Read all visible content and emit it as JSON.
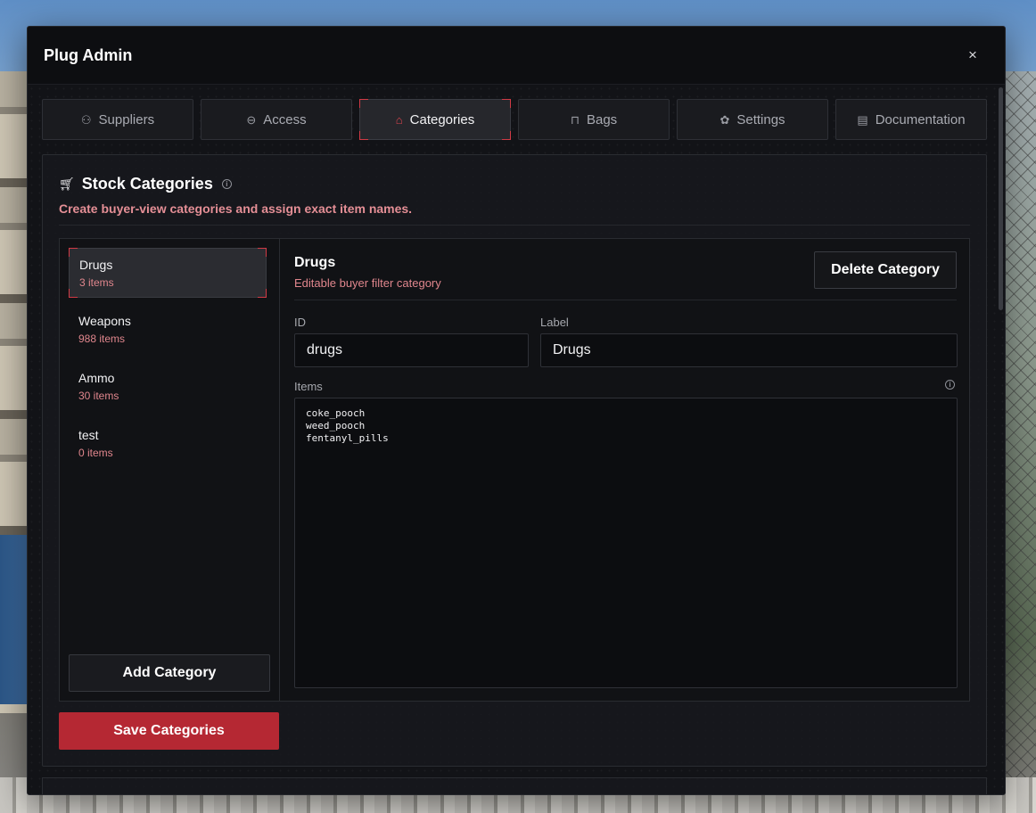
{
  "window": {
    "title": "Plug Admin",
    "close_glyph": "×"
  },
  "tabs": [
    {
      "label": "Suppliers",
      "icon": "user-plus-icon",
      "glyph": "⚇",
      "active": false
    },
    {
      "label": "Access",
      "icon": "link-icon",
      "glyph": "⊖",
      "active": false
    },
    {
      "label": "Categories",
      "icon": "tag-icon",
      "glyph": "⌂",
      "active": true
    },
    {
      "label": "Bags",
      "icon": "bag-icon",
      "glyph": "⊓",
      "active": false
    },
    {
      "label": "Settings",
      "icon": "palette-icon",
      "glyph": "✿",
      "active": false
    },
    {
      "label": "Documentation",
      "icon": "document-icon",
      "glyph": "▤",
      "active": false
    }
  ],
  "panel": {
    "title": "Stock Categories",
    "subtitle": "Create buyer-view categories and assign exact item names."
  },
  "categories": [
    {
      "name": "Drugs",
      "count": "3 items",
      "selected": true
    },
    {
      "name": "Weapons",
      "count": "988 items",
      "selected": false
    },
    {
      "name": "Ammo",
      "count": "30 items",
      "selected": false
    },
    {
      "name": "test",
      "count": "0 items",
      "selected": false
    }
  ],
  "buttons": {
    "add_category": "Add Category",
    "delete_category": "Delete Category",
    "save_categories": "Save Categories"
  },
  "editor": {
    "title": "Drugs",
    "subtitle": "Editable buyer filter category",
    "id_label": "ID",
    "id_value": "drugs",
    "label_label": "Label",
    "label_value": "Drugs",
    "items_label": "Items",
    "items_value": "coke_pooch\nweed_pooch\nfentanyl_pills"
  },
  "colors": {
    "accent": "#d13a45",
    "save_button": "#b52833",
    "muted_pink": "#e0868d"
  }
}
